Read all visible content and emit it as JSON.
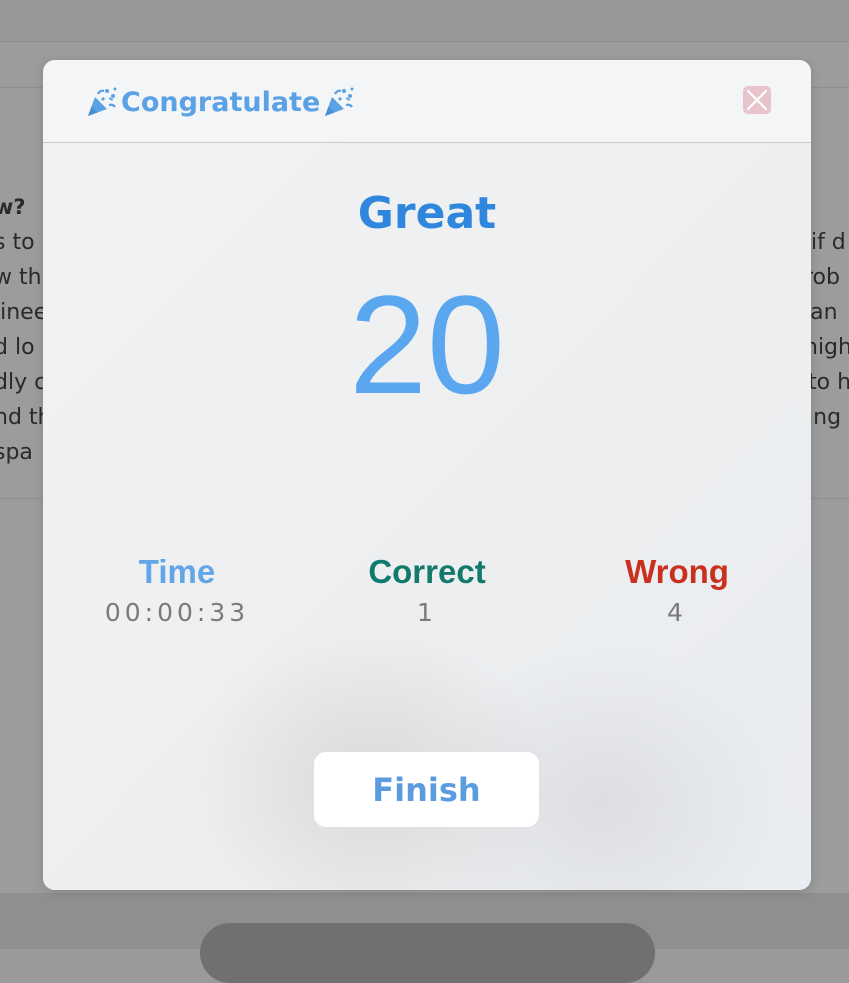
{
  "background": {
    "text_left": [
      "w?",
      "s to",
      "w th",
      "jinee",
      "d lo",
      "dly c",
      "nd th",
      "spa"
    ],
    "text_right": [
      "g if d",
      "rob",
      "lan",
      "high",
      "to h",
      "ving"
    ]
  },
  "modal": {
    "title": "Congratulate",
    "header_icon": "party-popper-icon",
    "close_icon": "close-icon",
    "rating": "Great",
    "score": "20",
    "stats": {
      "time": {
        "label": "Time",
        "value": "00:00:33"
      },
      "correct": {
        "label": "Correct",
        "value": "1"
      },
      "wrong": {
        "label": "Wrong",
        "value": "4"
      }
    },
    "finish_label": "Finish"
  },
  "colors": {
    "title": "#5aa1e6",
    "rating": "#2f86dd",
    "score": "#5aa7f0",
    "time_label": "#63a6e8",
    "correct_label": "#127a6c",
    "wrong_label": "#c9301d",
    "finish": "#5b9be0",
    "close_bg": "#e7c4cb",
    "close_x": "#ffffff"
  }
}
